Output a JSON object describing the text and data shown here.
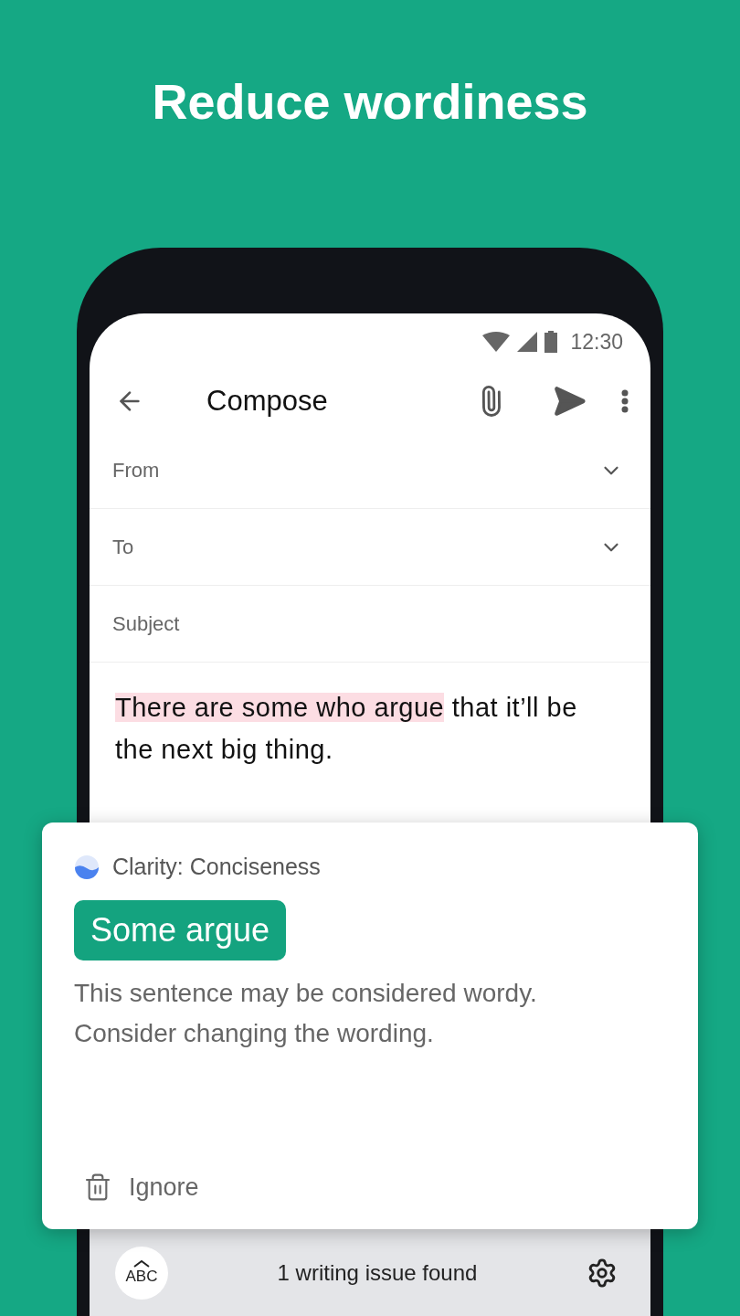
{
  "headline": "Reduce wordiness",
  "status_bar": {
    "time": "12:30"
  },
  "toolbar": {
    "title": "Compose"
  },
  "fields": [
    {
      "label": "From",
      "kind": "dropdown"
    },
    {
      "label": "To",
      "kind": "dropdown"
    },
    {
      "label": "Subject",
      "kind": "text"
    }
  ],
  "body": {
    "highlighted": "There are some who argue",
    "rest": " that it’ll be the next big thing."
  },
  "suggestion_card": {
    "category": "Clarity: Conciseness",
    "replacement": "Some argue",
    "description": "This sentence may be considered wordy. Consider changing the wording.",
    "action": "Ignore"
  },
  "bottom_bar": {
    "keyboard_key": "ABC",
    "status": "1 writing issue found"
  }
}
